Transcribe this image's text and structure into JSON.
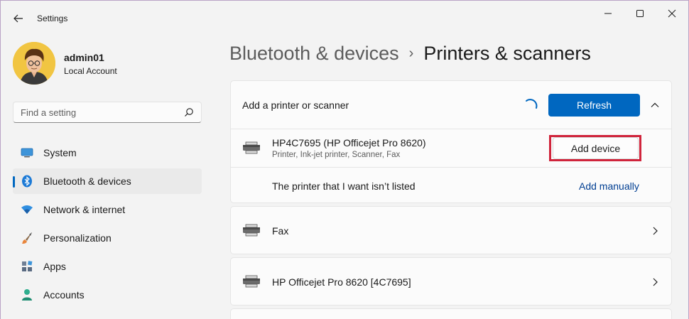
{
  "window": {
    "title": "Settings"
  },
  "user": {
    "name": "admin01",
    "account_type": "Local Account"
  },
  "search": {
    "placeholder": "Find a setting"
  },
  "sidebar": {
    "items": [
      {
        "label": "System",
        "icon": "monitor-icon",
        "active": false
      },
      {
        "label": "Bluetooth & devices",
        "icon": "bluetooth-icon",
        "active": true
      },
      {
        "label": "Network & internet",
        "icon": "wifi-icon",
        "active": false
      },
      {
        "label": "Personalization",
        "icon": "brush-icon",
        "active": false
      },
      {
        "label": "Apps",
        "icon": "apps-icon",
        "active": false
      },
      {
        "label": "Accounts",
        "icon": "person-icon",
        "active": false
      }
    ]
  },
  "breadcrumb": {
    "parent": "Bluetooth & devices",
    "separator": "›",
    "current": "Printers & scanners"
  },
  "add_printer": {
    "label": "Add a printer or scanner",
    "refresh_label": "Refresh",
    "found_device": {
      "name": "HP4C7695 (HP Officejet Pro 8620)",
      "details": "Printer, Ink-jet printer, Scanner, Fax",
      "action_label": "Add device"
    },
    "not_listed": {
      "label": "The printer that I want isn’t listed",
      "action_label": "Add manually"
    }
  },
  "printers": [
    {
      "name": "Fax"
    },
    {
      "name": "HP Officejet Pro 8620 [4C7695]"
    }
  ],
  "colors": {
    "accent": "#0067c0",
    "highlight": "#d0243b",
    "link": "#003e92"
  }
}
